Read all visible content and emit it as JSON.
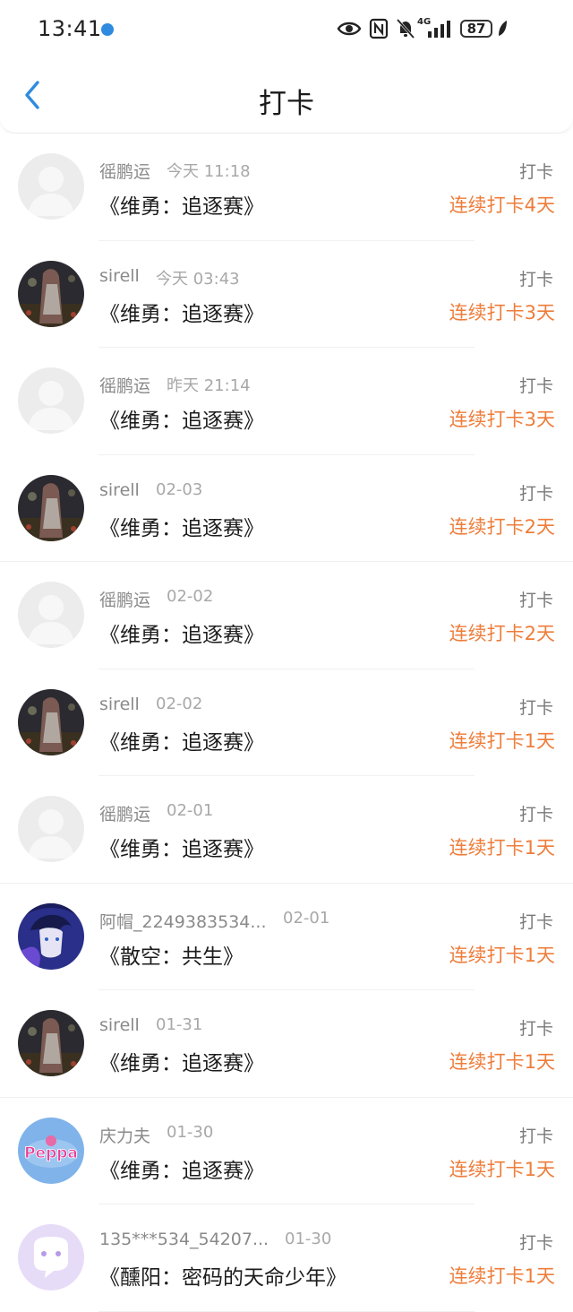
{
  "status_bar": {
    "time": "13:41",
    "network": "4G",
    "battery": "87",
    "icons": [
      "eye-icon",
      "nfc-icon",
      "mute-bell-icon",
      "signal-icon",
      "leaf-icon"
    ]
  },
  "header": {
    "title": "打卡",
    "back_icon": "chevron-left-icon"
  },
  "colors": {
    "accent_blue": "#2f8be0",
    "streak_orange": "#ee7d3b",
    "meta_gray": "#a8a8a8"
  },
  "items": [
    {
      "user": "徭鹏运",
      "time": "今天 11:18",
      "book": "《维勇：追逐赛》",
      "action": "打卡",
      "streak": "连续打卡4天",
      "avatar": "default"
    },
    {
      "user": "sirell",
      "time": "今天 03:43",
      "book": "《维勇：追逐赛》",
      "action": "打卡",
      "streak": "连续打卡3天",
      "avatar": "dark"
    },
    {
      "user": "徭鹏运",
      "time": "昨天 21:14",
      "book": "《维勇：追逐赛》",
      "action": "打卡",
      "streak": "连续打卡3天",
      "avatar": "default"
    },
    {
      "user": "sirell",
      "time": "02-03",
      "book": "《维勇：追逐赛》",
      "action": "打卡",
      "streak": "连续打卡2天",
      "avatar": "dark"
    },
    {
      "user": "徭鹏运",
      "time": "02-02",
      "book": "《维勇：追逐赛》",
      "action": "打卡",
      "streak": "连续打卡2天",
      "avatar": "default"
    },
    {
      "user": "sirell",
      "time": "02-02",
      "book": "《维勇：追逐赛》",
      "action": "打卡",
      "streak": "连续打卡1天",
      "avatar": "dark"
    },
    {
      "user": "徭鹏运",
      "time": "02-01",
      "book": "《维勇：追逐赛》",
      "action": "打卡",
      "streak": "连续打卡1天",
      "avatar": "default"
    },
    {
      "user": "阿帽_2249383534...",
      "time": "02-01",
      "book": "《散空：共生》",
      "action": "打卡",
      "streak": "连续打卡1天",
      "avatar": "anime"
    },
    {
      "user": "sirell",
      "time": "01-31",
      "book": "《维勇：追逐赛》",
      "action": "打卡",
      "streak": "连续打卡1天",
      "avatar": "dark"
    },
    {
      "user": "庆力夫",
      "time": "01-30",
      "book": "《维勇：追逐赛》",
      "action": "打卡",
      "streak": "连续打卡1天",
      "avatar": "peppa"
    },
    {
      "user": "135***534_54207...",
      "time": "01-30",
      "book": "《醺阳：密码的天命少年》",
      "action": "打卡",
      "streak": "连续打卡1天",
      "avatar": "purple"
    }
  ]
}
